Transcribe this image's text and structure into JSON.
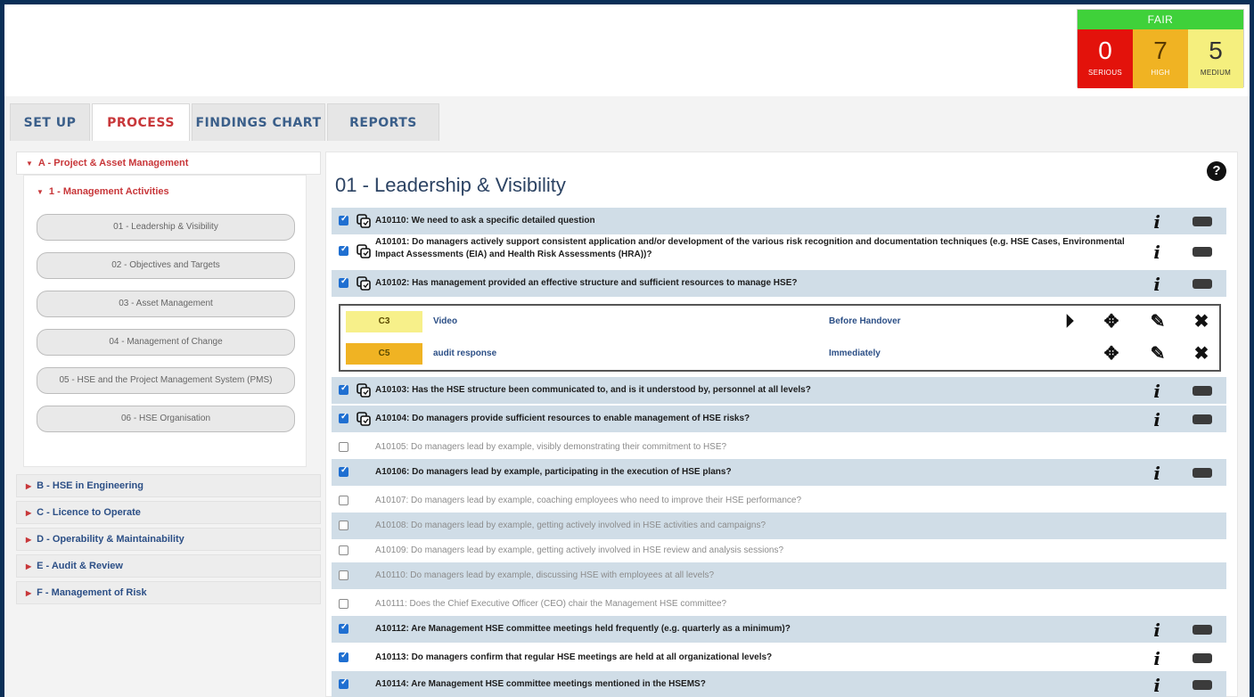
{
  "score": {
    "status": "FAIR",
    "cells": [
      {
        "value": "0",
        "label": "SERIOUS",
        "color": "#e3120b"
      },
      {
        "value": "7",
        "label": "HIGH",
        "color": "#f0b323"
      },
      {
        "value": "5",
        "label": "MEDIUM",
        "color": "#f5ef7e"
      }
    ]
  },
  "tabs": [
    {
      "label": "SET UP",
      "active": false
    },
    {
      "label": "PROCESS",
      "active": true
    },
    {
      "label": "FINDINGS CHART",
      "active": false
    },
    {
      "label": "REPORTS",
      "active": false
    }
  ],
  "sidebar": {
    "section_a": "A - Project & Asset Management",
    "subsection": "1 - Management Activities",
    "items": [
      "01 - Leadership & Visibility",
      "02 - Objectives and Targets",
      "03 - Asset Management",
      "04 - Management of Change",
      "05 - HSE and the Project Management System (PMS)",
      "06 - HSE Organisation"
    ],
    "sections": [
      "B - HSE in Engineering",
      "C - Licence to Operate",
      "D - Operability & Maintainability",
      "E - Audit & Review",
      "F - Management of Risk"
    ]
  },
  "main": {
    "title": "01 - Leadership & Visibility",
    "help": "?",
    "questions": [
      {
        "text": "A10110: We need to ask a specific detailed question",
        "checked": true,
        "active": true
      },
      {
        "text": "A10101: Do managers actively support consistent application and/or development of the various risk recognition and documentation techniques (e.g. HSE Cases, Environmental Impact Assessments (EIA) and Health Risk Assessments (HRA))?",
        "checked": true,
        "active": true
      },
      {
        "text": "A10102: Has management provided an effective structure and sufficient resources to manage HSE?",
        "checked": true,
        "active": true
      },
      {
        "text": "A10103: Has the HSE structure been communicated to, and is it understood by, personnel at all levels?",
        "checked": true,
        "active": true
      },
      {
        "text": "A10104: Do managers provide sufficient resources to enable management of HSE risks?",
        "checked": true,
        "active": true
      },
      {
        "text": "A10105: Do managers lead by example, visibly demonstrating their commitment to HSE?",
        "checked": false,
        "active": false
      },
      {
        "text": "A10106: Do managers lead by example, participating in the execution of HSE plans?",
        "checked": true,
        "active": true
      },
      {
        "text": "A10107: Do managers lead by example, coaching employees who need to improve their HSE performance?",
        "checked": false,
        "active": false
      },
      {
        "text": "A10108: Do managers lead by example, getting actively involved in HSE activities and campaigns?",
        "checked": false,
        "active": false
      },
      {
        "text": "A10109: Do managers lead by example, getting actively involved in HSE review and analysis sessions?",
        "checked": false,
        "active": false
      },
      {
        "text": "A10110: Do managers lead by example, discussing HSE with employees at all levels?",
        "checked": false,
        "active": false
      },
      {
        "text": "A10111: Does the Chief Executive Officer (CEO) chair the Management HSE committee?",
        "checked": false,
        "active": false
      },
      {
        "text": "A10112: Are Management HSE committee meetings held frequently (e.g. quarterly as a minimum)?",
        "checked": true,
        "active": true
      },
      {
        "text": "A10113: Do managers confirm that regular HSE meetings are held at all organizational levels?",
        "checked": true,
        "active": true
      },
      {
        "text": "A10114: Are Management HSE committee meetings mentioned in the HSEMS?",
        "checked": true,
        "active": true
      }
    ],
    "actions": [
      {
        "code": "C3",
        "code_color": "#f7f08a",
        "what": "Video",
        "when": "Before Handover"
      },
      {
        "code": "C5",
        "code_color": "#f0b323",
        "what": "audit response",
        "when": "Immediately"
      }
    ],
    "info_icon": "i",
    "tag_icon": "tag-icon"
  }
}
